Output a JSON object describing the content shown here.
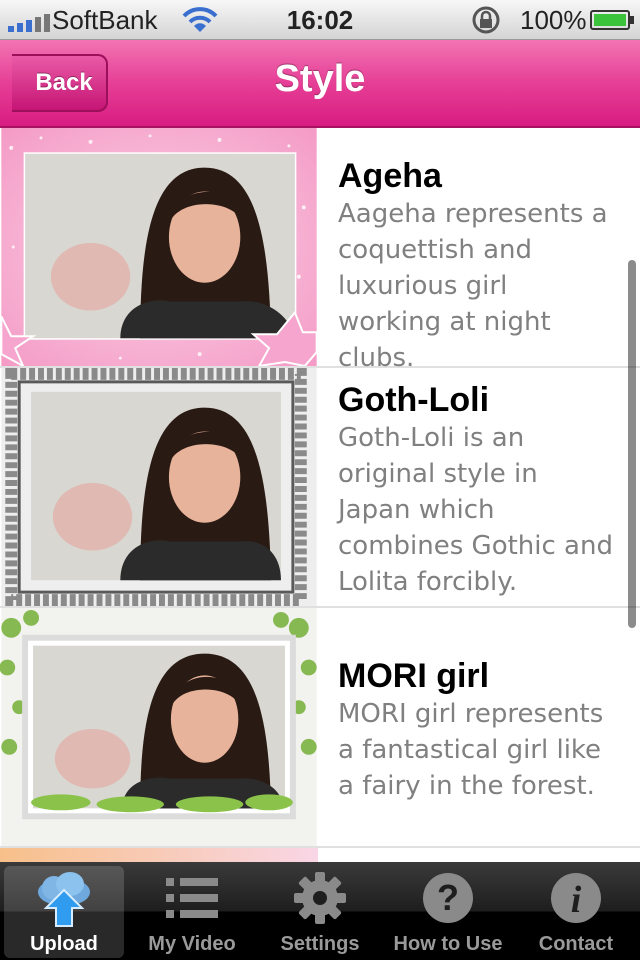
{
  "status_bar": {
    "carrier": "SoftBank",
    "time": "16:02",
    "battery": "100%"
  },
  "nav": {
    "back_label": "Back",
    "title": "Style"
  },
  "styles": [
    {
      "title": "Ageha",
      "description": "Aageha represents a coquettish and luxurious girl working at night clubs."
    },
    {
      "title": "Goth-Loli",
      "description": "Goth-Loli is an original style in Japan which combines Gothic and Lolita forcibly."
    },
    {
      "title": "MORI girl",
      "description": "MORI girl represents a fantastical girl like a fairy in the forest."
    }
  ],
  "tabs": [
    {
      "label": "Upload",
      "icon": "cloud-upload-icon",
      "active": true
    },
    {
      "label": "My Video",
      "icon": "list-icon",
      "active": false
    },
    {
      "label": "Settings",
      "icon": "gear-icon",
      "active": false
    },
    {
      "label": "How to Use",
      "icon": "question-icon",
      "active": false
    },
    {
      "label": "Contact",
      "icon": "info-icon",
      "active": false
    }
  ],
  "colors": {
    "nav_pink": "#e63f96",
    "status_signal": "#3a6fd0",
    "battery_green": "#3cc33c"
  }
}
